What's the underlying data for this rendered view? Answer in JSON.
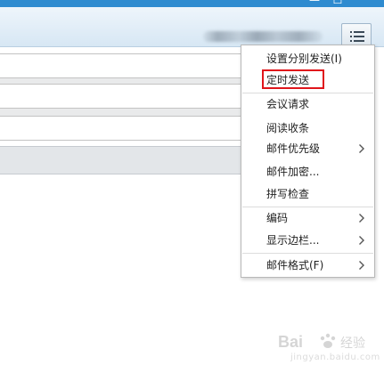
{
  "window": {
    "minimize_glyph": "—",
    "maximize_glyph": "☐",
    "title_bar_color": "#2f8bd0"
  },
  "toolbar": {
    "menu_icon": "list-icon"
  },
  "menu": {
    "items": [
      {
        "label": "设置分别发送(I)",
        "has_submenu": false
      },
      {
        "label": "定时发送",
        "has_submenu": false,
        "highlighted": true
      },
      {
        "label": "会议请求",
        "has_submenu": false
      },
      {
        "label": "阅读收条",
        "has_submenu": false
      },
      {
        "label": "邮件优先级",
        "has_submenu": true
      },
      {
        "label": "邮件加密...",
        "has_submenu": false
      },
      {
        "label": "拼写检查",
        "has_submenu": false
      },
      {
        "label": "编码",
        "has_submenu": true
      },
      {
        "label": "显示边栏...",
        "has_submenu": true
      },
      {
        "label": "邮件格式(F)",
        "has_submenu": true
      }
    ],
    "highlight_color": "#e0151b"
  },
  "watermark": {
    "logo_text": "Bai",
    "logo_text_2": "经验",
    "url": "jingyan.baidu.com"
  }
}
